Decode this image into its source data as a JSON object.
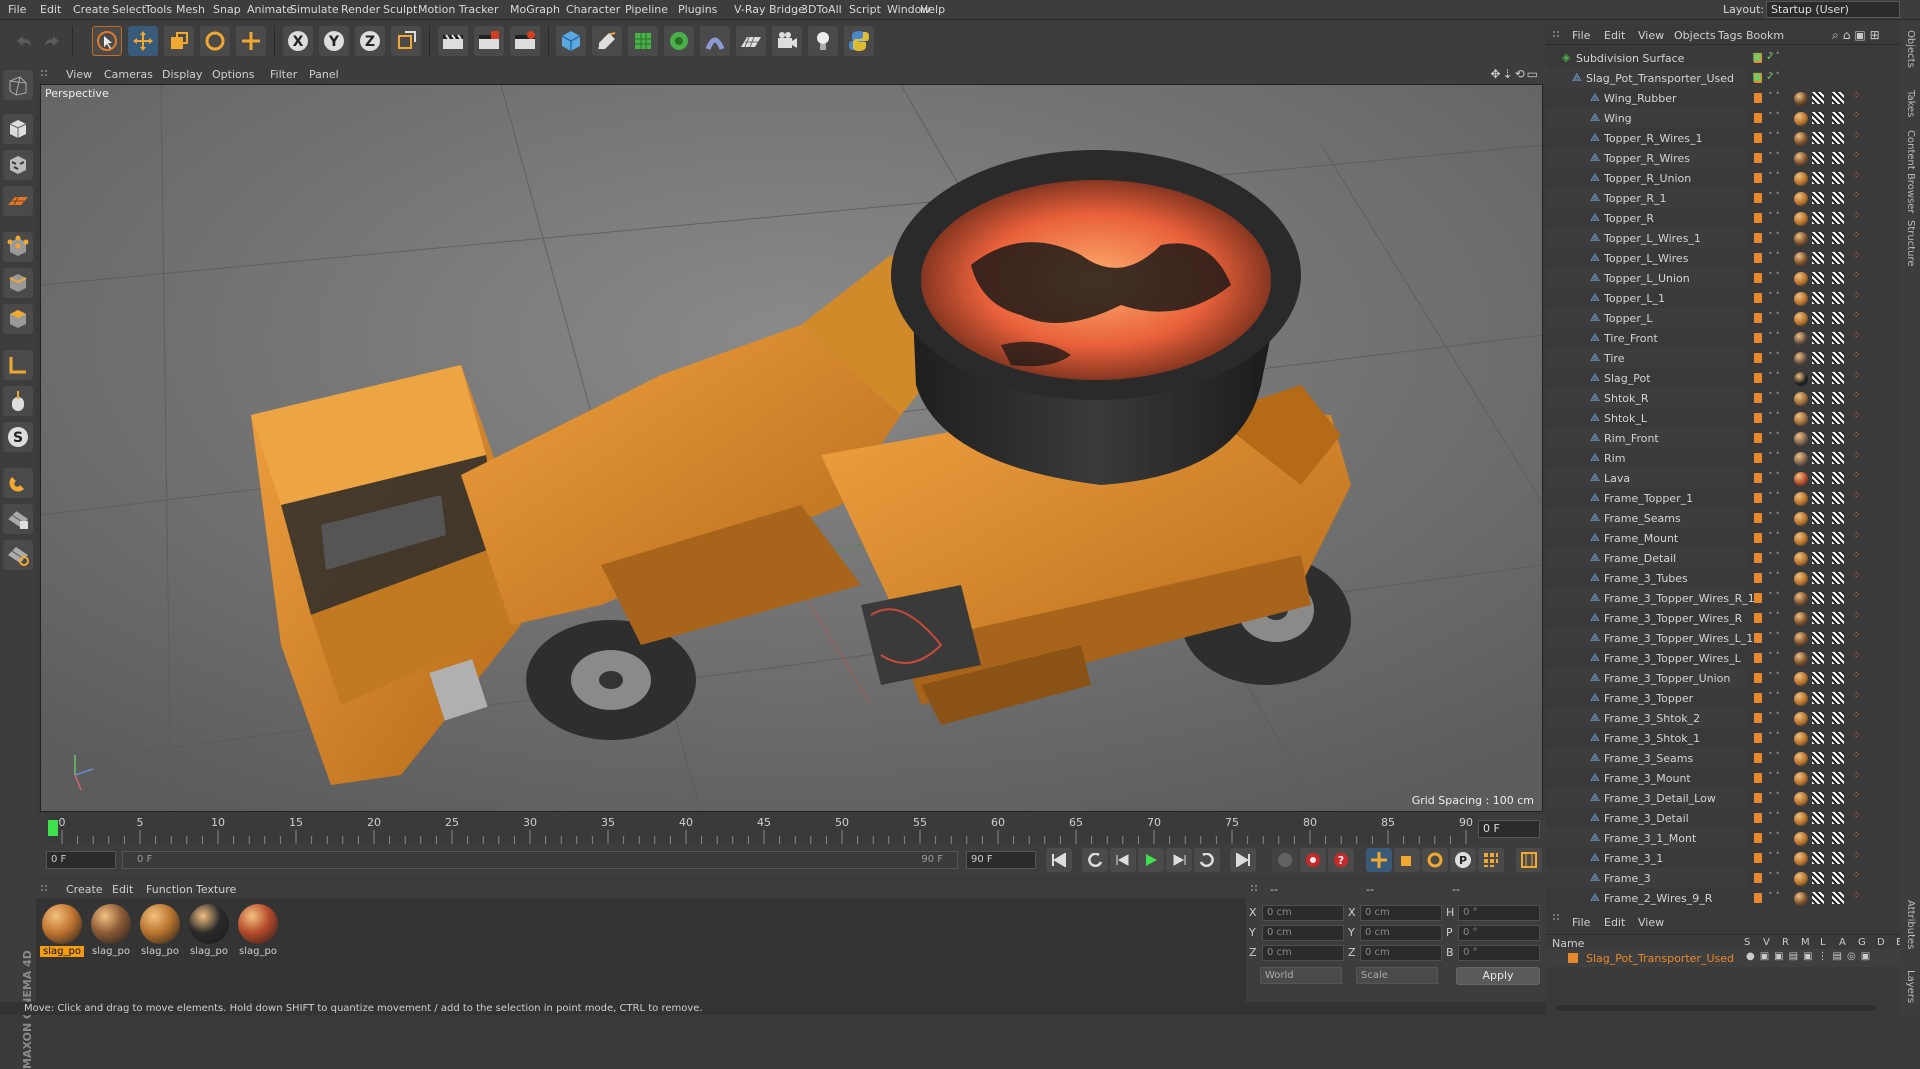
{
  "menubar": {
    "items": [
      "File",
      "Edit",
      "Create",
      "Select",
      "Tools",
      "Mesh",
      "Snap",
      "Animate",
      "Simulate",
      "Render",
      "Sculpt",
      "Motion Tracker",
      "MoGraph",
      "Character",
      "Pipeline",
      "Plugins",
      "V-Ray Bridge",
      "3DToAll",
      "Script",
      "Window",
      "Help"
    ],
    "layout_label": "Layout:",
    "layout_value": "Startup (User)"
  },
  "toolbar": {
    "axis_x": "X",
    "axis_y": "Y",
    "axis_z": "Z"
  },
  "left_tools": {
    "snap_label": "S",
    "brand": "MAXON CINEMA 4D"
  },
  "viewport": {
    "menu": [
      "View",
      "Cameras",
      "Display",
      "Options",
      "Filter",
      "Panel"
    ],
    "camera_label": "Perspective",
    "grid_spacing": "Grid Spacing : 100 cm",
    "scene_colors": {
      "body": "#d88a24",
      "lava": "#f07a3a",
      "pot": "#2c2c2c",
      "tire": "#303030",
      "bg": "#6b6b6b"
    }
  },
  "timeline": {
    "ticks": [
      "0",
      "5",
      "10",
      "15",
      "20",
      "25",
      "30",
      "35",
      "40",
      "45",
      "50",
      "55",
      "60",
      "65",
      "70",
      "75",
      "80",
      "85",
      "90"
    ],
    "current_frame": "0 F"
  },
  "transport": {
    "start_field": "0 F",
    "range_start": "0 F",
    "range_end": "90 F",
    "end_field": "90 F"
  },
  "materials": {
    "menu": [
      "Create",
      "Edit",
      "Function",
      "Texture"
    ],
    "items": [
      {
        "label": "slag_po",
        "color": "#c07430",
        "selected": true
      },
      {
        "label": "slag_po",
        "color": "#8a5a36",
        "selected": false
      },
      {
        "label": "slag_po",
        "color": "#b8742e",
        "selected": false
      },
      {
        "label": "slag_po",
        "color": "#2a2a2a",
        "selected": false
      },
      {
        "label": "slag_po",
        "color": "#b54a2a",
        "selected": false
      }
    ]
  },
  "coords": {
    "header": [
      "--",
      "--",
      "--"
    ],
    "rows": [
      {
        "l1": "X",
        "v1": "0 cm",
        "l2": "X",
        "v2": "0 cm",
        "l3": "H",
        "v3": "0 °"
      },
      {
        "l1": "Y",
        "v1": "0 cm",
        "l2": "Y",
        "v2": "0 cm",
        "l3": "P",
        "v3": "0 °"
      },
      {
        "l1": "Z",
        "v1": "0 cm",
        "l2": "Z",
        "v2": "0 cm",
        "l3": "B",
        "v3": "0 °"
      }
    ],
    "space": "World",
    "mode": "Scale",
    "apply": "Apply"
  },
  "status": "Move: Click and drag to move elements. Hold down SHIFT to quantize movement / add to the selection in point mode, CTRL to remove.",
  "object_manager": {
    "menu": [
      "File",
      "Edit",
      "View",
      "Objects",
      "Tags",
      "Bookm"
    ],
    "root": "Subdivision Surface",
    "group": "Slag_Pot_Transporter_Used",
    "objects": [
      {
        "name": "Wing_Rubber",
        "tex": "#6a4a2a"
      },
      {
        "name": "Wing",
        "tex": "#b5722c"
      },
      {
        "name": "Topper_R_Wires_1",
        "tex": "#7a5030"
      },
      {
        "name": "Topper_R_Wires",
        "tex": "#7a5030"
      },
      {
        "name": "Topper_R_Union",
        "tex": "#b5722c"
      },
      {
        "name": "Topper_R_1",
        "tex": "#b5722c"
      },
      {
        "name": "Topper_R",
        "tex": "#b5722c"
      },
      {
        "name": "Topper_L_Wires_1",
        "tex": "#7a5030"
      },
      {
        "name": "Topper_L_Wires",
        "tex": "#7a5030"
      },
      {
        "name": "Topper_L_Union",
        "tex": "#b5722c"
      },
      {
        "name": "Topper_L_1",
        "tex": "#b5722c"
      },
      {
        "name": "Topper_L",
        "tex": "#b5722c"
      },
      {
        "name": "Tire_Front",
        "tex": "#5a4a40"
      },
      {
        "name": "Tire",
        "tex": "#5a4a40"
      },
      {
        "name": "Slag_Pot",
        "tex": "#222222"
      },
      {
        "name": "Shtok_R",
        "tex": "#9a6a3a"
      },
      {
        "name": "Shtok_L",
        "tex": "#9a6a3a"
      },
      {
        "name": "Rim_Front",
        "tex": "#7a6050"
      },
      {
        "name": "Rim",
        "tex": "#7a6050"
      },
      {
        "name": "Lava",
        "tex": "#b54a2a"
      },
      {
        "name": "Frame_Topper_1",
        "tex": "#b5722c"
      },
      {
        "name": "Frame_Seams",
        "tex": "#b5722c"
      },
      {
        "name": "Frame_Mount",
        "tex": "#b5722c"
      },
      {
        "name": "Frame_Detail",
        "tex": "#b5722c"
      },
      {
        "name": "Frame_3_Tubes",
        "tex": "#b5722c"
      },
      {
        "name": "Frame_3_Topper_Wires_R_1",
        "tex": "#7a5030"
      },
      {
        "name": "Frame_3_Topper_Wires_R",
        "tex": "#7a5030"
      },
      {
        "name": "Frame_3_Topper_Wires_L_1",
        "tex": "#7a5030"
      },
      {
        "name": "Frame_3_Topper_Wires_L",
        "tex": "#7a5030"
      },
      {
        "name": "Frame_3_Topper_Union",
        "tex": "#b5722c"
      },
      {
        "name": "Frame_3_Topper",
        "tex": "#b5722c"
      },
      {
        "name": "Frame_3_Shtok_2",
        "tex": "#b5722c"
      },
      {
        "name": "Frame_3_Shtok_1",
        "tex": "#b5722c"
      },
      {
        "name": "Frame_3_Seams",
        "tex": "#b5722c"
      },
      {
        "name": "Frame_3_Mount",
        "tex": "#b5722c"
      },
      {
        "name": "Frame_3_Detail_Low",
        "tex": "#b5722c"
      },
      {
        "name": "Frame_3_Detail",
        "tex": "#b5722c"
      },
      {
        "name": "Frame_3_1_Mont",
        "tex": "#b5722c"
      },
      {
        "name": "Frame_3_1",
        "tex": "#b5722c"
      },
      {
        "name": "Frame_3",
        "tex": "#b5722c"
      },
      {
        "name": "Frame_2_Wires_9_R",
        "tex": "#7a5030"
      }
    ]
  },
  "layers": {
    "menu": [
      "File",
      "Edit",
      "View"
    ],
    "col_name": "Name",
    "cols": [
      "S",
      "V",
      "R",
      "M",
      "L",
      "A",
      "G",
      "D",
      "E"
    ],
    "layer_name": "Slag_Pot_Transporter_Used",
    "layer_color": "#e8882c"
  },
  "right_tabs": [
    "Objects",
    "Takes",
    "Content Browser",
    "Structure",
    "Attributes",
    "Layers"
  ]
}
